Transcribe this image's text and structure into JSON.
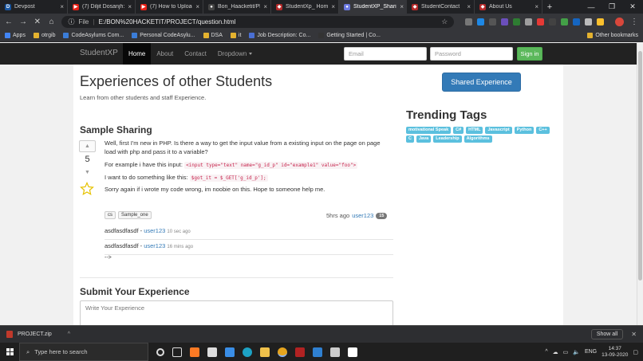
{
  "browser": {
    "tabs": [
      {
        "title": "Devpost",
        "fav_color": "#1a56a0",
        "fav_glyph": "D",
        "active": false
      },
      {
        "title": "(7) Diljit Dosanjh: S",
        "fav_color": "#e62117",
        "fav_glyph": "▶",
        "active": false
      },
      {
        "title": "(7) How to Upload",
        "fav_color": "#e62117",
        "fav_glyph": "▶",
        "active": false
      },
      {
        "title": "Bon_Haacketit/PRO",
        "fav_color": "#444444",
        "fav_glyph": "●",
        "active": false
      },
      {
        "title": "StudentXp_ Home",
        "fav_color": "#b52a2a",
        "fav_glyph": "◆",
        "active": false
      },
      {
        "title": "StudentXP_Sharing",
        "fav_color": "#6c7ae0",
        "fav_glyph": "●",
        "active": true
      },
      {
        "title": "StudentContact",
        "fav_color": "#b52a2a",
        "fav_glyph": "◆",
        "active": false
      },
      {
        "title": "About Us",
        "fav_color": "#b52a2a",
        "fav_glyph": "◆",
        "active": false
      }
    ],
    "close_glyph": "×",
    "newtab_glyph": "+",
    "window_controls": [
      "—",
      "❐",
      "✕"
    ],
    "address": {
      "scheme_label": "File",
      "url": "E:/BON%20HACKETIT/PROJECT/question.html"
    },
    "bookmarks": [
      {
        "label": "Apps",
        "color": "#4285f4"
      },
      {
        "label": "otrgib",
        "color": "#e4b22f"
      },
      {
        "label": "CodeAsylums Com...",
        "color": "#3b7dd8"
      },
      {
        "label": "Personal CodeAsylu...",
        "color": "#3b7dd8"
      },
      {
        "label": "DSA",
        "color": "#e4b22f"
      },
      {
        "label": "it",
        "color": "#e4b22f"
      },
      {
        "label": "Job Description: Co...",
        "color": "#4a6fd3"
      },
      {
        "label": "Getting Started | Co...",
        "color": "#333333"
      }
    ],
    "other_bookmarks": "Other bookmarks"
  },
  "site": {
    "brand": "StudentXP",
    "nav": [
      {
        "label": "Home",
        "active": true
      },
      {
        "label": "About",
        "active": false
      },
      {
        "label": "Contact",
        "active": false
      },
      {
        "label": "Dropdown",
        "active": false
      }
    ],
    "email_placeholder": "Email",
    "password_placeholder": "Password",
    "signin_label": "Sign in"
  },
  "page": {
    "title": "Experiences of other Students",
    "subtitle": "Learn from other students and staff Experience.",
    "shared_button": "Shared Experience",
    "trending_title": "Trending Tags",
    "trending_tags": [
      "motivational Speak",
      "C#",
      "HTML",
      "Javascript",
      "Python",
      "C++",
      "C",
      "Java",
      "Leadership",
      "Algorithms"
    ],
    "sample_title": "Sample Sharing",
    "vote_count": "5",
    "question_text": "Well, first I'm new in PHP. Is there a way to get the input value from a existing input on the page on page load with php and pass it to a variable?",
    "example_label": "For example i have this input:",
    "example_code": "<input type=\"text\" name=\"g_id_p\" id=\"example1\" value=\"foo\">",
    "want_label": "I want to do something like this:",
    "want_code": "$got_it = $_GET['g_id_p'];",
    "sorry_text": "Sorry again if i wrote my code wrong, im noobie on this. Hope to someone help me.",
    "question_tags": [
      "cs",
      "Sample_one"
    ],
    "asked_time": "5hrs ago",
    "asked_user": "user123",
    "asked_badge": "15",
    "comments": [
      {
        "text": "asdfasdfasdf",
        "sep": " - ",
        "user": "user123",
        "time": "10 sec ago"
      },
      {
        "text": "asdfasdfasdf",
        "sep": " - ",
        "user": "user123",
        "time": "16 mins ago"
      }
    ],
    "stray_text": "-->",
    "submit_title": "Submit Your Experience",
    "textarea_placeholder": "Write Your Experience"
  },
  "downloads": {
    "file": "PROJECT.zip",
    "show_all": "Show all"
  },
  "taskbar": {
    "search_placeholder": "Type here to search",
    "language": "ENG",
    "time": "14:37",
    "date": "13-09-2020"
  }
}
